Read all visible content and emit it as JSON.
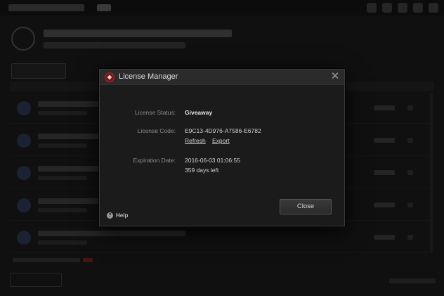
{
  "dialog": {
    "title": "License Manager",
    "close_glyph": "✕",
    "icon": "app-logo-icon",
    "license_status_label": "License Status:",
    "license_status_value": "Giveaway",
    "license_code_label": "License Code:",
    "license_code_value": "E9C13-4D976-A7586-E6782",
    "refresh_link": "Refresh",
    "export_link": "Export",
    "expiration_label": "Expiration Date:",
    "expiration_value": "2016-06-03 01:06:55",
    "days_left": "359 days left",
    "help_label": "Help",
    "close_button": "Close"
  },
  "colors": {
    "dialog_bg": "#1b1b1b",
    "header_bg": "#2b2b2b",
    "accent_red": "#7a1616"
  }
}
